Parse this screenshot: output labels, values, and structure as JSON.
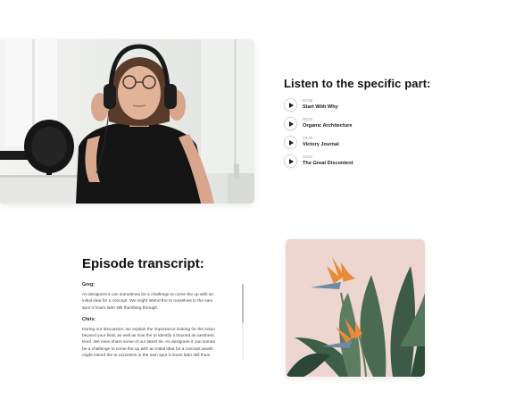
{
  "chapters": {
    "heading": "Listen to the specific part:",
    "items": [
      {
        "time": "07:08",
        "title": "Start With Why"
      },
      {
        "time": "09:02",
        "title": "Organic Architecture"
      },
      {
        "time": "19:46",
        "title": "Victory Journal"
      },
      {
        "time": "23:51",
        "title": "The Great Discontent"
      }
    ]
  },
  "transcript": {
    "heading": "Episode transcript:",
    "blocks": [
      {
        "speaker": "Greg:",
        "lines": [
          "As designers it can sometimes be a challenge to come the up with an",
          "initial idea for a concept. We might intend the to ourselves in the sam",
          "spot 3 hours later still thumbing through."
        ]
      },
      {
        "speaker": "Chris:",
        "lines": [
          "During our discussion, we explain the importance looking for the inspo",
          "beyond your field, as well as how the to identify it beyond an aesthetic",
          "level. We even share some of our latest tin. As designers it can someti",
          "be a challenge to come the up with an initial idea for a concept.weath",
          "might intend the to ourselves in the sam spot 3 hours later still thum"
        ]
      }
    ]
  },
  "colors": {
    "accent": "#111111",
    "hero_bg": "#e9ebe8",
    "plant_bg": "#ecd6cf",
    "flower": "#e98a3a"
  },
  "icons": {
    "play": "play-icon"
  }
}
